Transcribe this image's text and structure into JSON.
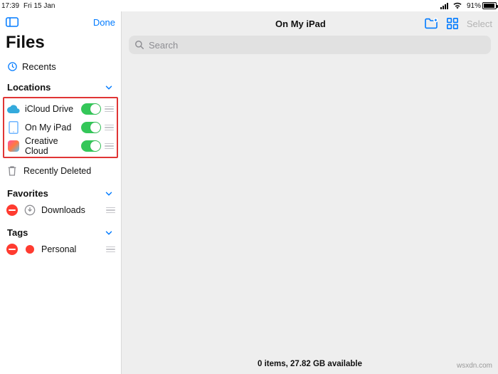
{
  "status": {
    "time": "17:39",
    "date": "Fri 15 Jan",
    "battery_pct": "91%",
    "battery_fill": 91
  },
  "sidebar": {
    "done": "Done",
    "title": "Files",
    "recents": "Recents",
    "sections": {
      "locations": {
        "title": "Locations",
        "items": [
          {
            "label": "iCloud Drive"
          },
          {
            "label": "On My iPad"
          },
          {
            "label": "Creative Cloud"
          }
        ],
        "deleted": "Recently Deleted"
      },
      "favorites": {
        "title": "Favorites",
        "items": [
          {
            "label": "Downloads"
          }
        ]
      },
      "tags": {
        "title": "Tags",
        "items": [
          {
            "label": "Personal"
          }
        ]
      }
    }
  },
  "content": {
    "title": "On My iPad",
    "select": "Select",
    "search": {
      "placeholder": "Search"
    },
    "footer": "0 items, 27.82 GB available"
  },
  "watermark": "wsxdn.com"
}
